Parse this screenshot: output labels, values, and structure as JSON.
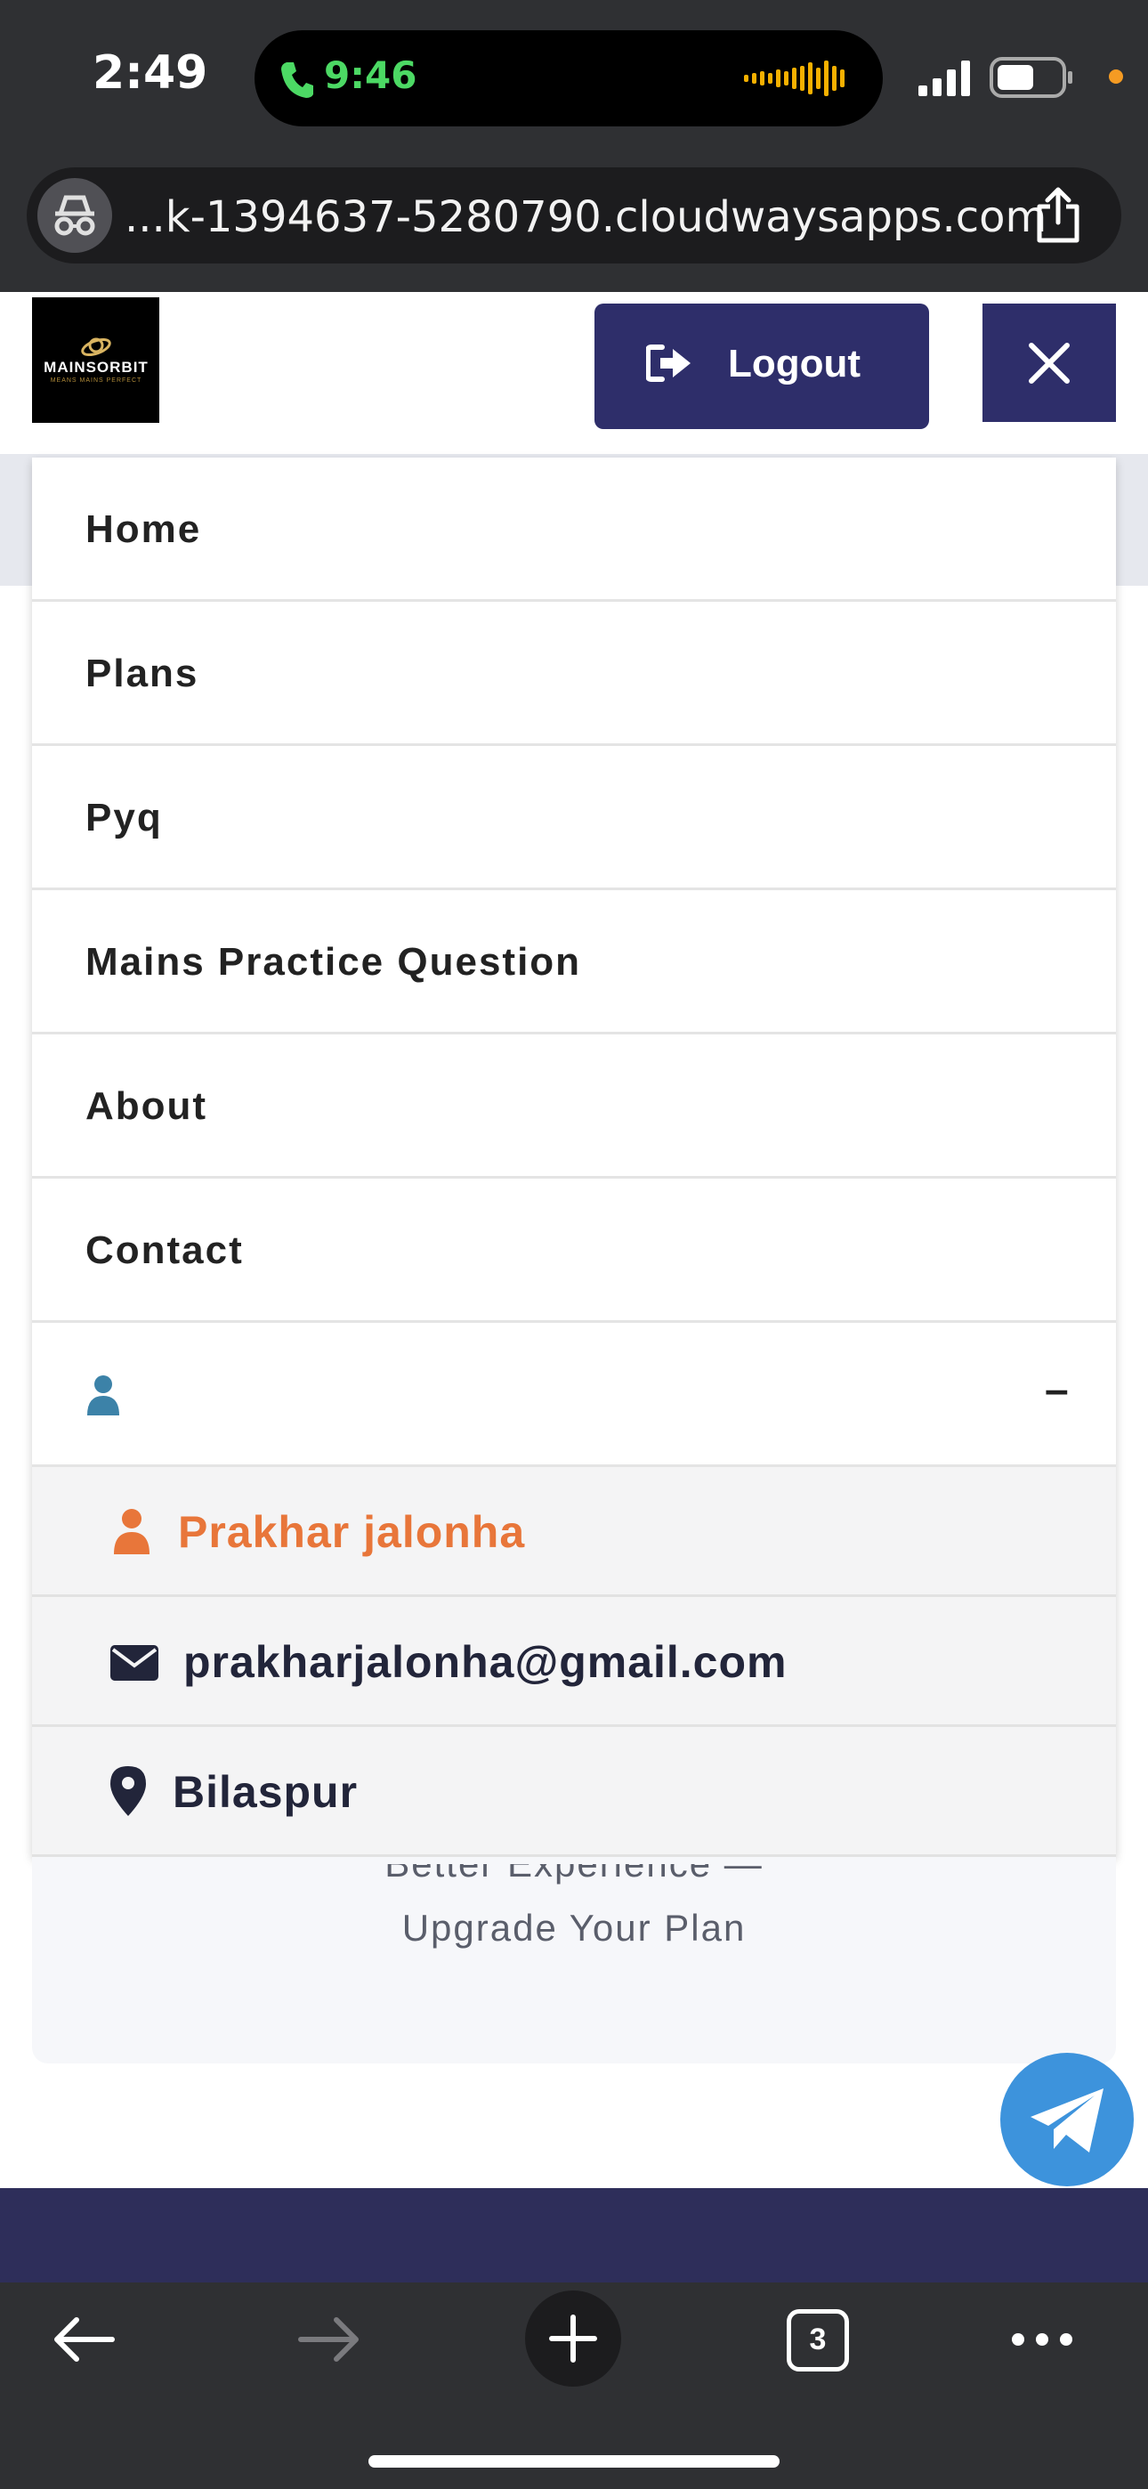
{
  "status_bar": {
    "time": "2:49",
    "call_time": "9:46",
    "call_color": "#4cd964"
  },
  "browser": {
    "url": "...k-1394637-5280790.cloudwaysapps.com",
    "private_icon": "incognito-icon",
    "share_icon": "share-icon",
    "tab_count": "3"
  },
  "header": {
    "logo_text": "MAINSORBIT",
    "logo_tagline": "MEANS MAINS PERFECT",
    "logout_label": "Logout",
    "accent_color": "#2e2e6a"
  },
  "menu": {
    "items": [
      {
        "label": "Home"
      },
      {
        "label": "Plans"
      },
      {
        "label": "Pyq"
      },
      {
        "label": "Mains Practice Question"
      },
      {
        "label": "About"
      },
      {
        "label": "Contact"
      }
    ],
    "user_toggle_symbol": "–",
    "user": {
      "name": "Prakhar jalonha",
      "email": "prakharjalonha@gmail.com",
      "location": "Bilaspur",
      "name_color": "#e8763a"
    }
  },
  "card": {
    "line1": "Better Experience —",
    "line2": "Upgrade Your Plan"
  }
}
